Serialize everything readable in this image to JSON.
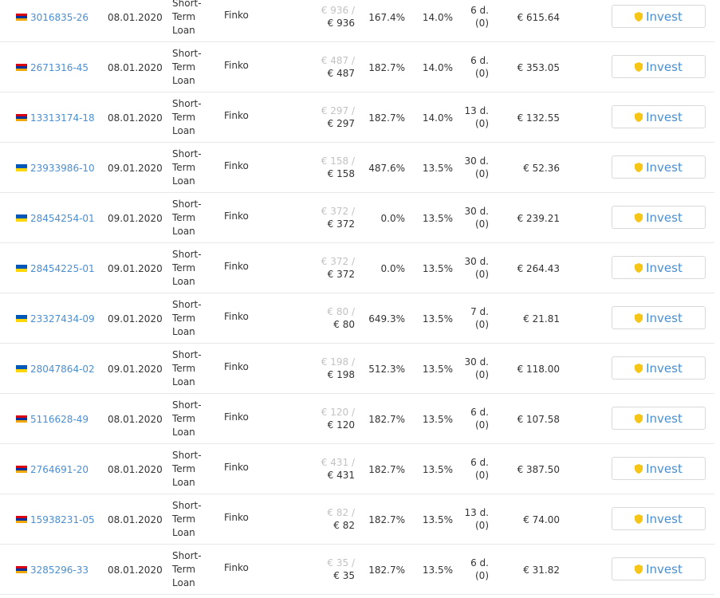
{
  "flags": {
    "armenia": [
      "#d90012",
      "#0033a0",
      "#f2a800"
    ],
    "ukraine": [
      "#0057b7",
      "#ffd700"
    ]
  },
  "colors": {
    "link": "#4a8fd4",
    "shield": "#f5c518",
    "muted": "#c2c2c2"
  },
  "invest_label": "Invest",
  "loans": [
    {
      "flag": "armenia",
      "id": "3016835-26",
      "date": "08.01.2020",
      "type": [
        "Short-",
        "Term",
        "Loan"
      ],
      "originator": "Finko",
      "available": "€ 936 /",
      "total": "€ 936",
      "interest": "167.4%",
      "rate": "14.0%",
      "term": "6 d.",
      "term_extra": "(0)",
      "price": "€ 615.64"
    },
    {
      "flag": "armenia",
      "id": "2671316-45",
      "date": "08.01.2020",
      "type": [
        "Short-",
        "Term",
        "Loan"
      ],
      "originator": "Finko",
      "available": "€ 487 /",
      "total": "€ 487",
      "interest": "182.7%",
      "rate": "14.0%",
      "term": "6 d.",
      "term_extra": "(0)",
      "price": "€ 353.05"
    },
    {
      "flag": "armenia",
      "id": "13313174-18",
      "date": "08.01.2020",
      "type": [
        "Short-",
        "Term",
        "Loan"
      ],
      "originator": "Finko",
      "available": "€ 297 /",
      "total": "€ 297",
      "interest": "182.7%",
      "rate": "14.0%",
      "term": "13 d.",
      "term_extra": "(0)",
      "price": "€ 132.55"
    },
    {
      "flag": "ukraine",
      "id": "23933986-10",
      "date": "09.01.2020",
      "type": [
        "Short-",
        "Term",
        "Loan"
      ],
      "originator": "Finko",
      "available": "€ 158 /",
      "total": "€ 158",
      "interest": "487.6%",
      "rate": "13.5%",
      "term": "30 d.",
      "term_extra": "(0)",
      "price": "€ 52.36"
    },
    {
      "flag": "ukraine",
      "id": "28454254-01",
      "date": "09.01.2020",
      "type": [
        "Short-",
        "Term",
        "Loan"
      ],
      "originator": "Finko",
      "available": "€ 372 /",
      "total": "€ 372",
      "interest": "0.0%",
      "rate": "13.5%",
      "term": "30 d.",
      "term_extra": "(0)",
      "price": "€ 239.21"
    },
    {
      "flag": "ukraine",
      "id": "28454225-01",
      "date": "09.01.2020",
      "type": [
        "Short-",
        "Term",
        "Loan"
      ],
      "originator": "Finko",
      "available": "€ 372 /",
      "total": "€ 372",
      "interest": "0.0%",
      "rate": "13.5%",
      "term": "30 d.",
      "term_extra": "(0)",
      "price": "€ 264.43"
    },
    {
      "flag": "ukraine",
      "id": "23327434-09",
      "date": "09.01.2020",
      "type": [
        "Short-",
        "Term",
        "Loan"
      ],
      "originator": "Finko",
      "available": "€ 80 /",
      "total": "€ 80",
      "interest": "649.3%",
      "rate": "13.5%",
      "term": "7 d.",
      "term_extra": "(0)",
      "price": "€ 21.81"
    },
    {
      "flag": "ukraine",
      "id": "28047864-02",
      "date": "09.01.2020",
      "type": [
        "Short-",
        "Term",
        "Loan"
      ],
      "originator": "Finko",
      "available": "€ 198 /",
      "total": "€ 198",
      "interest": "512.3%",
      "rate": "13.5%",
      "term": "30 d.",
      "term_extra": "(0)",
      "price": "€ 118.00"
    },
    {
      "flag": "armenia",
      "id": "5116628-49",
      "date": "08.01.2020",
      "type": [
        "Short-",
        "Term",
        "Loan"
      ],
      "originator": "Finko",
      "available": "€ 120 /",
      "total": "€ 120",
      "interest": "182.7%",
      "rate": "13.5%",
      "term": "6 d.",
      "term_extra": "(0)",
      "price": "€ 107.58"
    },
    {
      "flag": "armenia",
      "id": "2764691-20",
      "date": "08.01.2020",
      "type": [
        "Short-",
        "Term",
        "Loan"
      ],
      "originator": "Finko",
      "available": "€ 431 /",
      "total": "€ 431",
      "interest": "182.7%",
      "rate": "13.5%",
      "term": "6 d.",
      "term_extra": "(0)",
      "price": "€ 387.50"
    },
    {
      "flag": "armenia",
      "id": "15938231-05",
      "date": "08.01.2020",
      "type": [
        "Short-",
        "Term",
        "Loan"
      ],
      "originator": "Finko",
      "available": "€ 82 /",
      "total": "€ 82",
      "interest": "182.7%",
      "rate": "13.5%",
      "term": "13 d.",
      "term_extra": "(0)",
      "price": "€ 74.00"
    },
    {
      "flag": "armenia",
      "id": "3285296-33",
      "date": "08.01.2020",
      "type": [
        "Short-",
        "Term",
        "Loan"
      ],
      "originator": "Finko",
      "available": "€ 35 /",
      "total": "€ 35",
      "interest": "182.7%",
      "rate": "13.5%",
      "term": "6 d.",
      "term_extra": "(0)",
      "price": "€ 31.82"
    }
  ]
}
